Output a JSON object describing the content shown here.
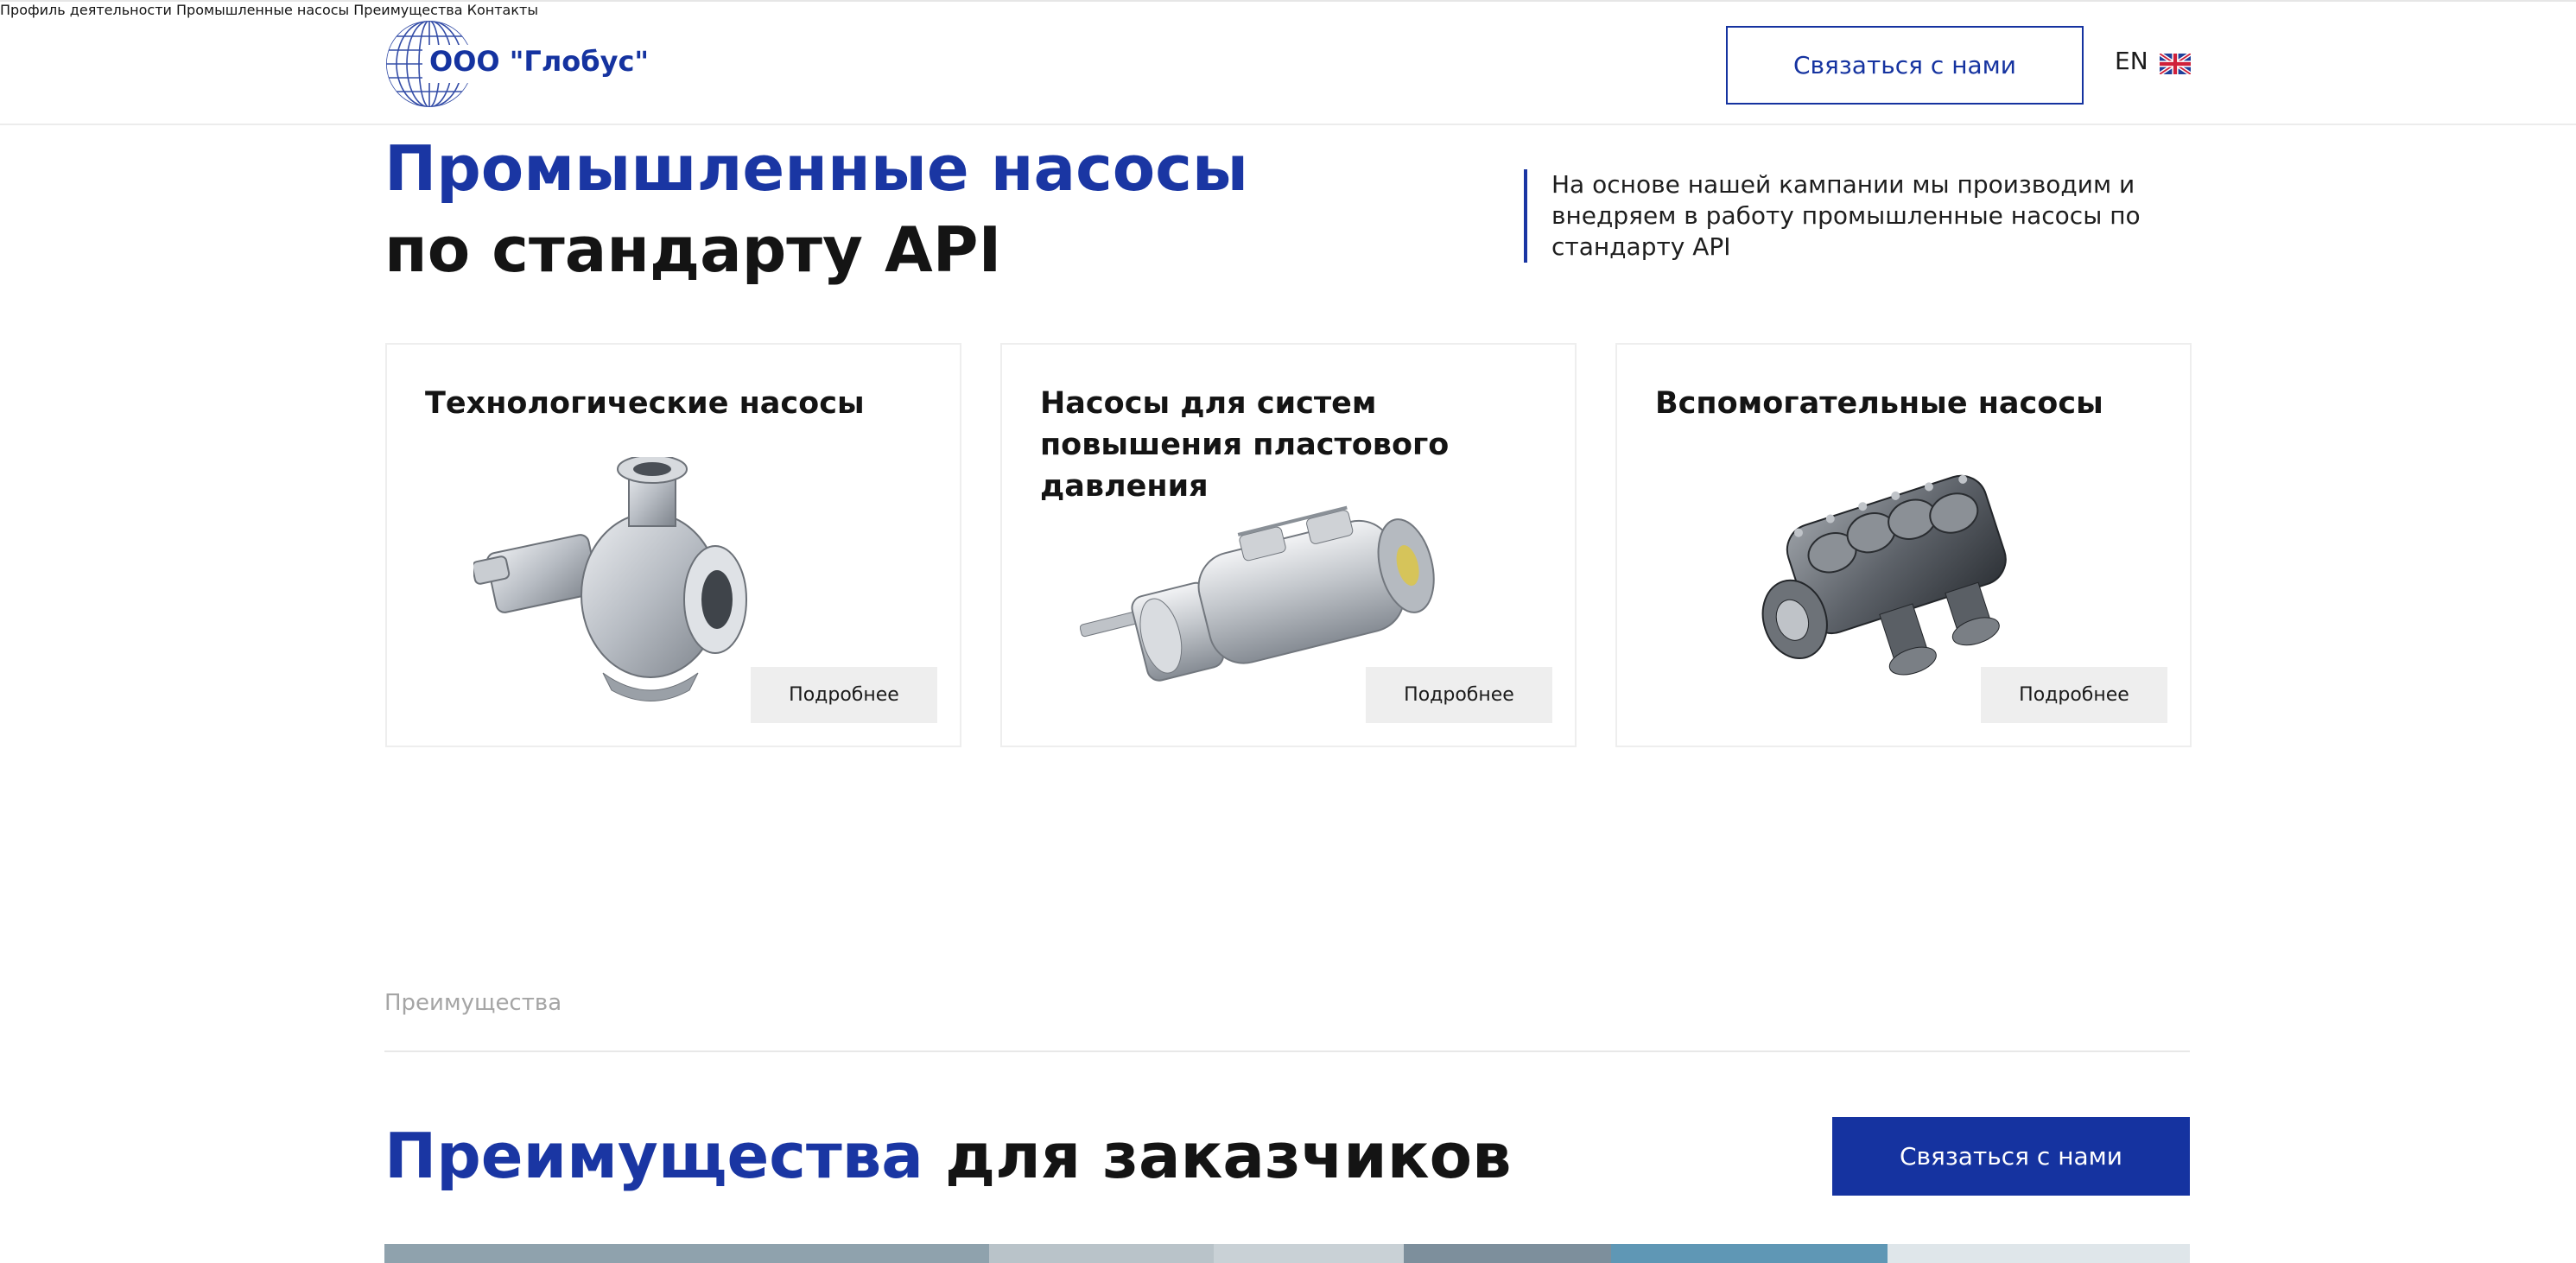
{
  "header": {
    "logo_text": "ООО \"Глобус\"",
    "nav": [
      {
        "label": "Профиль деятельности"
      },
      {
        "label": "Промышленные насосы"
      },
      {
        "label": "Преимущества"
      },
      {
        "label": "Контакты"
      }
    ],
    "cta_label": "Связаться с нами",
    "lang_label": "EN",
    "flag_icon": "uk-flag-icon"
  },
  "hero": {
    "title_accent": "Промышленные насосы",
    "title_dark": "по стандарту API",
    "note": "На основе нашей кампании мы производим и внедряем в работу промышленные насосы по стандарту API"
  },
  "cards": [
    {
      "title": "Технологические насосы",
      "button": "Подробнее",
      "image": "centrifugal-pump-image"
    },
    {
      "title": "Насосы для систем повышения пластового давления",
      "button": "Подробнее",
      "image": "barrel-pump-image"
    },
    {
      "title": "Вспомогательные насосы",
      "button": "Подробнее",
      "image": "split-case-pump-image"
    }
  ],
  "advantages": {
    "section_label": "Преимущества",
    "title_accent": "Преимущества",
    "title_dark": "для заказчиков",
    "cta_label": "Связаться с нами"
  },
  "colors": {
    "accent": "#1533a0",
    "text": "#141414",
    "muted": "#a5a5a5",
    "button_bg": "#eeeeee"
  }
}
